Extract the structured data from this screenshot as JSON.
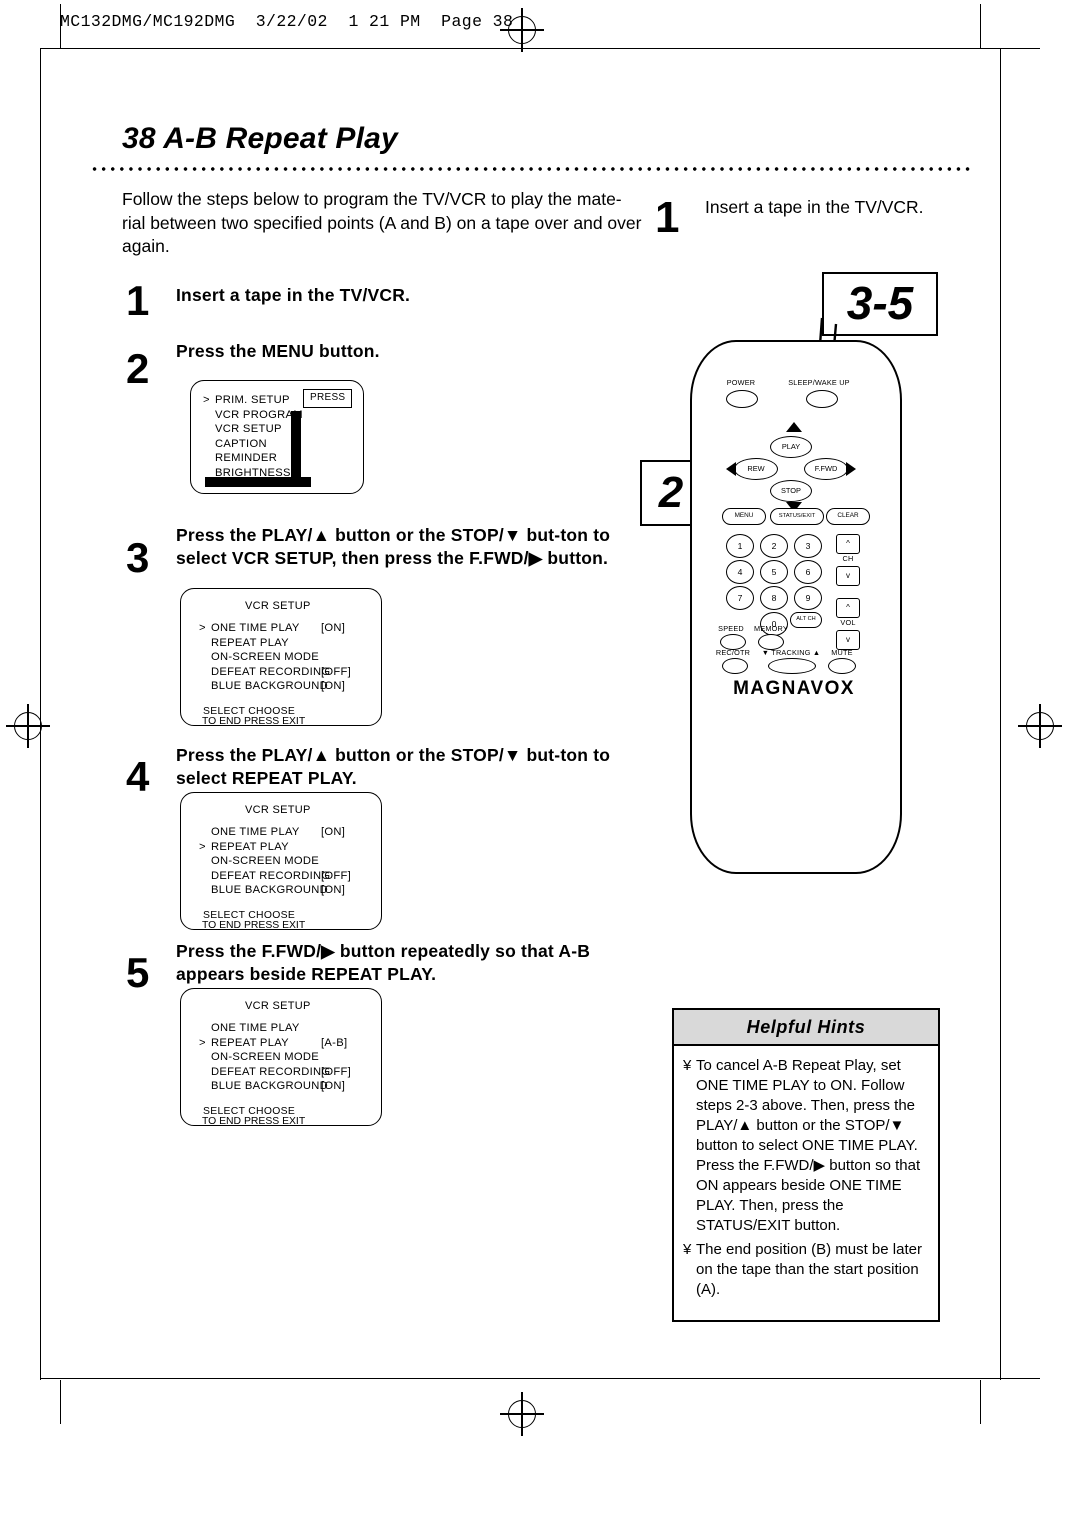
{
  "slug": "MC132DMG/MC192DMG  3/22/02  1 21 PM  Page 38",
  "title": "38  A-B Repeat Play",
  "intro": "Follow the steps below to program the TV/VCR to play the mate-rial between two specified points (A and B) on a tape over and over again.",
  "steps": [
    {
      "num": "1",
      "text": "Insert a tape in the TV/VCR."
    },
    {
      "num": "2",
      "text": "Press the MENU button."
    },
    {
      "num": "3",
      "text": "Press the PLAY/▲ button or the STOP/▼ but-ton to select VCR SETUP, then press the F.FWD/▶ button."
    },
    {
      "num": "4",
      "text": "Press the PLAY/▲ button or the STOP/▼ but-ton to select REPEAT PLAY."
    },
    {
      "num": "5",
      "text": "Press the F.FWD/▶ button repeatedly so that A-B appears beside REPEAT PLAY."
    }
  ],
  "osd_menu": {
    "press_label": "PRESS",
    "items": [
      "PRIM. SETUP",
      "VCR PROGRAM",
      "VCR SETUP",
      "CAPTION",
      "REMINDER",
      "BRIGHTNESS"
    ],
    "cursor_index": 0
  },
  "osd_setup_1": {
    "title": "VCR SETUP",
    "rows": [
      {
        "label": "ONE TIME PLAY",
        "value": "[ON]"
      },
      {
        "label": "REPEAT PLAY",
        "value": ""
      },
      {
        "label": "ON-SCREEN MODE",
        "value": ""
      },
      {
        "label": "DEFEAT RECORDING",
        "value": "[OFF]"
      },
      {
        "label": "BLUE BACKGROUND",
        "value": "[ON]"
      }
    ],
    "cursor_index": 0,
    "footer1": "SELECT         CHOOSE",
    "footer2": "TO END PRESS EXIT"
  },
  "osd_setup_2": {
    "title": "VCR SETUP",
    "rows": [
      {
        "label": "ONE TIME PLAY",
        "value": "[ON]"
      },
      {
        "label": "REPEAT PLAY",
        "value": ""
      },
      {
        "label": "ON-SCREEN MODE",
        "value": ""
      },
      {
        "label": "DEFEAT RECORDING",
        "value": "[OFF]"
      },
      {
        "label": "BLUE BACKGROUND",
        "value": "[ON]"
      }
    ],
    "cursor_index": 1,
    "footer1": "SELECT         CHOOSE",
    "footer2": "TO END PRESS EXIT"
  },
  "osd_setup_3": {
    "title": "VCR SETUP",
    "rows": [
      {
        "label": "ONE TIME PLAY",
        "value": ""
      },
      {
        "label": "REPEAT PLAY",
        "value": "[A-B]"
      },
      {
        "label": "ON-SCREEN MODE",
        "value": ""
      },
      {
        "label": "DEFEAT RECORDING",
        "value": "[OFF]"
      },
      {
        "label": "BLUE BACKGROUND",
        "value": "[ON]"
      }
    ],
    "cursor_index": 1,
    "footer1": "SELECT         CHOOSE",
    "footer2": "TO END PRESS EXIT"
  },
  "right": {
    "step1_num": "1",
    "step1_text": "Insert a tape in the TV/VCR.",
    "badge_35": "3-5",
    "badge_2": "2"
  },
  "remote": {
    "brand": "MAGNAVOX",
    "labels": {
      "power": "POWER",
      "sleep": "SLEEP/WAKE UP",
      "play": "PLAY",
      "rew": "REW",
      "ffwd": "F.FWD",
      "stop": "STOP",
      "menu": "MENU",
      "status": "STATUS/EXIT",
      "clear": "CLEAR",
      "ch": "CH",
      "vol": "VOL",
      "speed": "SPEED",
      "memory": "MEMORY",
      "alt_ch": "ALT CH",
      "rec_otr": "REC/OTR",
      "tracking": "TRACKING",
      "mute": "MUTE"
    },
    "keypad": [
      "1",
      "2",
      "3",
      "4",
      "5",
      "6",
      "7",
      "8",
      "9",
      "0"
    ]
  },
  "hints": {
    "heading": "Helpful Hints",
    "items": [
      "To cancel A-B Repeat Play, set ONE TIME PLAY to ON. Follow steps 2-3 above. Then, press the PLAY/▲ button or the STOP/▼ button to select ONE TIME PLAY. Press the F.FWD/▶ button so that ON appears beside ONE TIME PLAY.  Then, press the STATUS/EXIT button.",
      "The end position (B) must be later on the tape than the start position (A)."
    ],
    "bullet": "¥"
  }
}
